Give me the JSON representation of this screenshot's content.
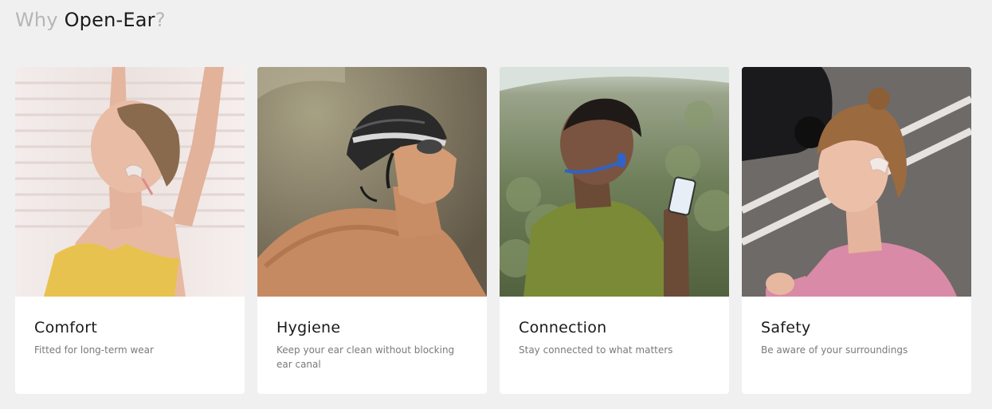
{
  "heading": {
    "prefix": "Why",
    "highlight": "Open-Ear",
    "suffix": "?"
  },
  "cards": [
    {
      "title": "Comfort",
      "description": "Fitted for long-term wear",
      "image_subject": "woman stretching arms overhead wearing open-ear headphones"
    },
    {
      "title": "Hygiene",
      "description": "Keep your ear clean without blocking ear canal",
      "image_subject": "swimmer in cap and goggles wearing open-ear headphones"
    },
    {
      "title": "Connection",
      "description": "Stay connected to what matters",
      "image_subject": "man in green shirt looking at phone wearing blue headphones"
    },
    {
      "title": "Safety",
      "description": "Be aware of your surroundings",
      "image_subject": "woman jogging on street wearing open-ear headphones"
    }
  ],
  "colors": {
    "page_background": "#f0f0f0",
    "card_background": "#ffffff",
    "heading_muted": "#b6b6b6",
    "heading_strong": "#1b1b1b",
    "title_text": "#1a1a1a",
    "description_text": "#7a7a7a"
  }
}
